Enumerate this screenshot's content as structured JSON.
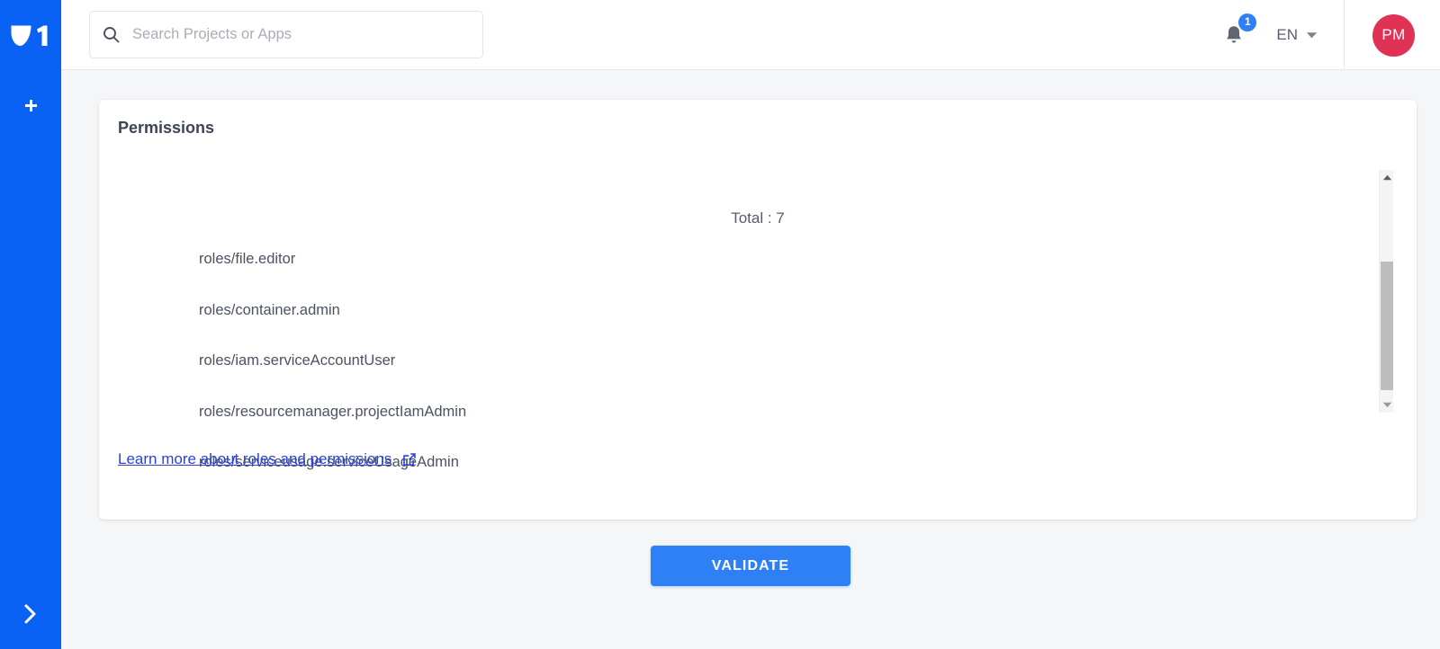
{
  "sidebar": {
    "logo_name": "onepoint-logo",
    "add_label": "+",
    "expand_label": "›"
  },
  "header": {
    "search": {
      "placeholder": "Search Projects or Apps",
      "value": ""
    },
    "notifications": {
      "icon": "bell-icon",
      "badge_count": "1"
    },
    "language": {
      "selected": "EN",
      "caret_icon": "chevron-down-icon"
    },
    "avatar": {
      "initials": "PM",
      "color": "#e03254"
    }
  },
  "card": {
    "title": "Permissions",
    "total_label": "Total : 7",
    "roles": [
      "roles/file.editor",
      "roles/container.admin",
      "roles/iam.serviceAccountUser",
      "roles/resourcemanager.projectIamAdmin",
      "roles/serviceusage.serviceUsageAdmin"
    ],
    "learn_more": {
      "text": "Learn more about roles and permissions",
      "icon": "external-link-icon"
    },
    "scrollbar": {
      "up_icon": "scroll-up-arrow-icon",
      "down_icon": "scroll-down-arrow-icon"
    }
  },
  "footer": {
    "validate_label": "VALIDATE"
  },
  "colors": {
    "brand_blue": "#0a62f4",
    "accent_blue": "#2f80f7",
    "link_blue": "#2b42d8",
    "avatar_red": "#e03254",
    "page_bg": "#f5f6f8"
  }
}
